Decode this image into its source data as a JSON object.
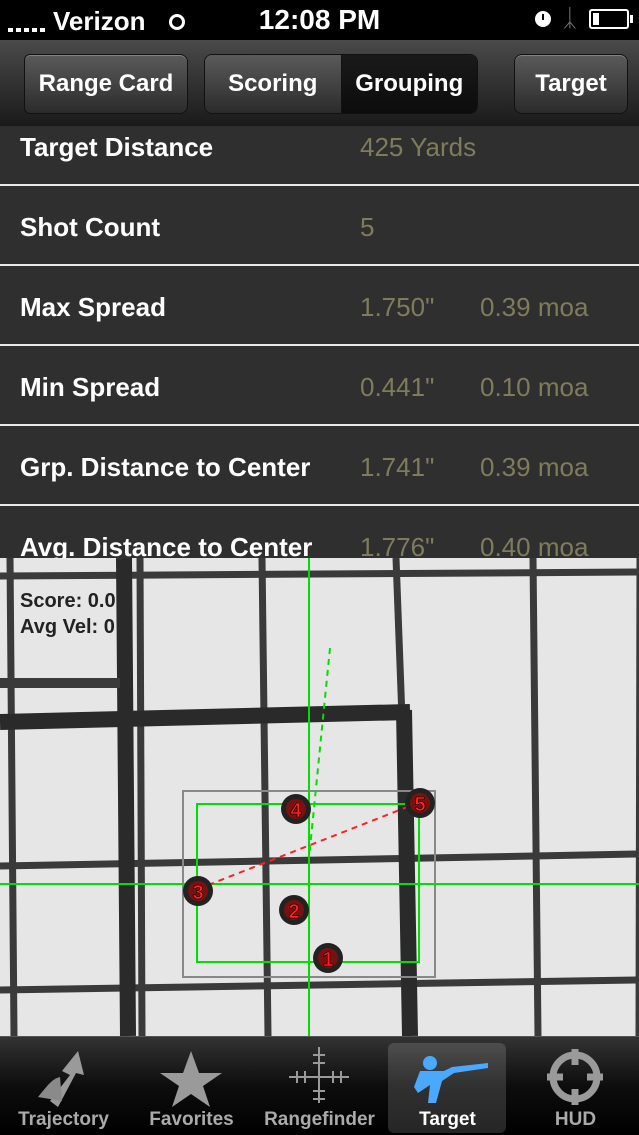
{
  "status_bar": {
    "carrier": "Verizon",
    "time": "12:08 PM"
  },
  "nav": {
    "back_label": "Range Card",
    "segments": [
      "Scoring",
      "Grouping"
    ],
    "selected_segment": "Grouping",
    "right_label": "Target"
  },
  "stats": [
    {
      "label": "Target Distance",
      "value1": "425 Yards",
      "value2": ""
    },
    {
      "label": "Shot Count",
      "value1": "5",
      "value2": ""
    },
    {
      "label": "Max Spread",
      "value1": "1.750\"",
      "value2": "0.39 moa"
    },
    {
      "label": "Min Spread",
      "value1": "0.441\"",
      "value2": "0.10 moa"
    },
    {
      "label": "Grp. Distance to Center",
      "value1": "1.741\"",
      "value2": "0.39 moa"
    },
    {
      "label": "Avg. Distance to Center",
      "value1": "1.776\"",
      "value2": "0.40 moa"
    }
  ],
  "target_overlay": {
    "score_text": "Score: 0.0",
    "avg_vel_text": "Avg Vel: 0",
    "shot_labels": [
      "1",
      "2",
      "3",
      "4",
      "5"
    ]
  },
  "tabs": [
    {
      "label": "Trajectory",
      "icon": "trajectory-icon"
    },
    {
      "label": "Favorites",
      "icon": "star-icon"
    },
    {
      "label": "Rangefinder",
      "icon": "reticle-icon"
    },
    {
      "label": "Target",
      "icon": "rifleman-icon"
    },
    {
      "label": "HUD",
      "icon": "hud-icon"
    }
  ],
  "active_tab": "Target",
  "colors": {
    "value_text": "#7f7c5c",
    "overlay_green": "#00ff00",
    "overlay_red": "#ff2020"
  }
}
